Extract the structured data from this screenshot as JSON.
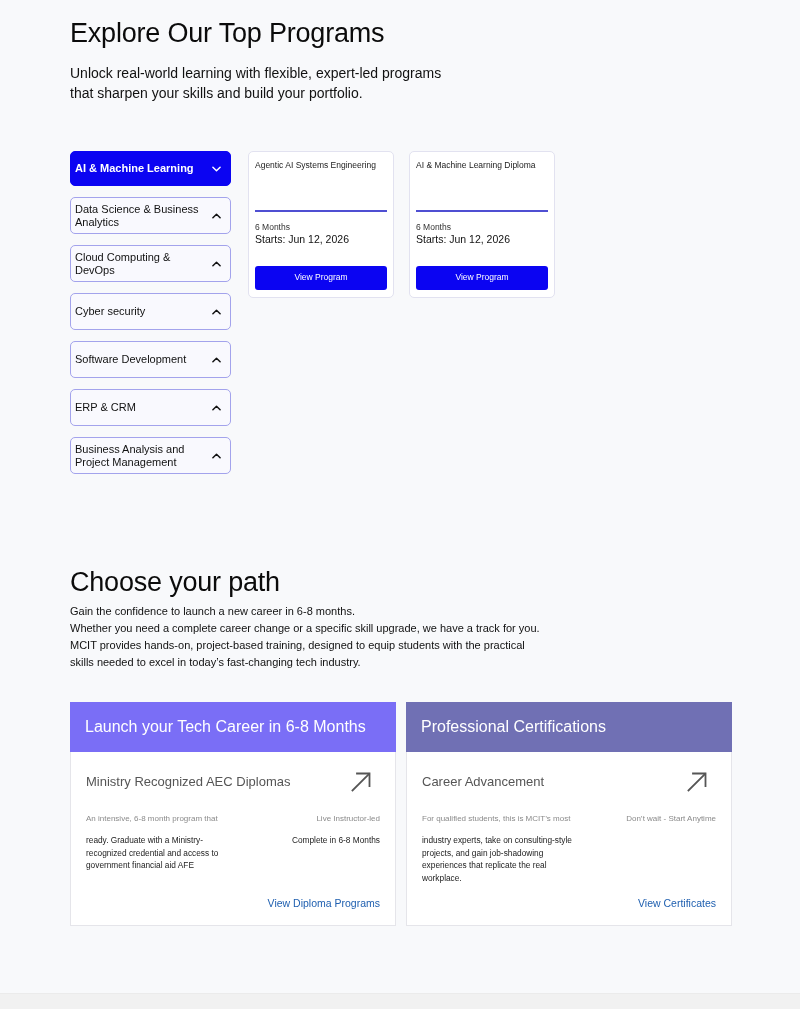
{
  "programs_section": {
    "title": "Explore Our Top Programs",
    "subtitle": "Unlock real-world learning with flexible, expert-led programs that sharpen your skills and build your portfolio."
  },
  "categories": [
    {
      "label": "AI & Machine Learning",
      "selected": true
    },
    {
      "label": "Data Science & Business Analytics",
      "selected": false
    },
    {
      "label": "Cloud Computing & DevOps",
      "selected": false
    },
    {
      "label": "Cyber security",
      "selected": false
    },
    {
      "label": "Software Development",
      "selected": false
    },
    {
      "label": "ERP & CRM",
      "selected": false
    },
    {
      "label": "Business Analysis and Project Management",
      "selected": false
    }
  ],
  "program_cards": [
    {
      "title": "Agentic AI Systems Engineering",
      "duration": "6 Months",
      "start": "Starts: Jun 12, 2026",
      "button": "View Program"
    },
    {
      "title": "AI & Machine Learning Diploma",
      "duration": "6 Months",
      "start": "Starts: Jun 12, 2026",
      "button": "View Program"
    }
  ],
  "path_section": {
    "title": "Choose your path",
    "paragraphs": [
      "Gain the confidence to launch a new career in 6-8 months.",
      "Whether you need a complete career change or a specific skill upgrade, we have a track for you.",
      "MCIT provides hands-on, project-based training, designed to equip students with the practical skills needed to excel in today’s fast-changing tech industry."
    ]
  },
  "path_cards": [
    {
      "title": "Launch your Tech Career in 6-8 Months",
      "color": "#7a6ef6",
      "subtitle": "Ministry Recognized AEC Diplomas",
      "summary": "An intensive, 6-8 month program that",
      "feature": "Live Instructor-led",
      "description": "ready. Graduate with a Ministry-recognized credential and access to government financial aid AFE",
      "features": [
        "Complete in 6-8 Months"
      ],
      "link": "View Diploma Programs"
    },
    {
      "title": "Professional Certifications",
      "color": "#7070b4",
      "subtitle": "Career Advancement",
      "summary": "For qualified students, this is MCIT’s most",
      "feature": "Don’t wait - Start Anytime",
      "description": "industry experts, take on consulting-style projects, and gain job-shadowing experiences that replicate the real workplace.",
      "link": "View Certificates"
    }
  ]
}
